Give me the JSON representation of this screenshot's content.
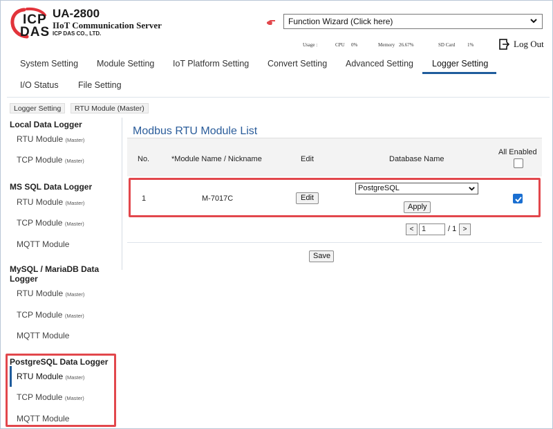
{
  "header": {
    "logo_line1": "ICP",
    "logo_line2": "DAS",
    "model": "UA-2800",
    "product": "IIoT Communication Server",
    "company": "ICP DAS CO., LTD.",
    "wizard_label": "Function Wizard  (Click here)",
    "usage": {
      "label": "Usage :",
      "cpu_label": "CPU",
      "cpu_value": "0%",
      "memory_label": "Memory",
      "memory_value": "26.67%",
      "sd_label": "SD Card",
      "sd_value": "1%"
    },
    "logout_label": "Log Out"
  },
  "tabs": {
    "system": "System Setting",
    "module": "Module Setting",
    "iot": "IoT Platform Setting",
    "convert": "Convert Setting",
    "advanced": "Advanced Setting",
    "logger": "Logger Setting",
    "io_status": "I/O Status",
    "file": "File Setting"
  },
  "breadcrumb": [
    "Logger Setting",
    "RTU Module (Master)"
  ],
  "sidebar": {
    "local": {
      "title": "Local Data Logger",
      "rtu": "RTU Module",
      "rtu_tag": "(Master)",
      "tcp": "TCP Module",
      "tcp_tag": "(Master)"
    },
    "mssql": {
      "title": "MS SQL Data Logger",
      "rtu": "RTU Module",
      "rtu_tag": "(Master)",
      "tcp": "TCP Module",
      "tcp_tag": "(Master)",
      "mqtt": "MQTT Module"
    },
    "mysql": {
      "title_line1": "MySQL / MariaDB Data",
      "title_line2": "Logger",
      "rtu": "RTU Module",
      "rtu_tag": "(Master)",
      "tcp": "TCP Module",
      "tcp_tag": "(Master)",
      "mqtt": "MQTT Module"
    },
    "postgres": {
      "title": "PostgreSQL Data Logger",
      "rtu": "RTU Module",
      "rtu_tag": "(Master)",
      "tcp": "TCP Module",
      "tcp_tag": "(Master)",
      "mqtt": "MQTT Module"
    }
  },
  "main": {
    "title": "Modbus RTU Module List",
    "columns": {
      "no": "No.",
      "name": "*Module Name / Nickname",
      "edit": "Edit",
      "db": "Database Name",
      "enabled": "All Enabled"
    },
    "row": {
      "no": "1",
      "name": "M-7017C",
      "edit_label": "Edit",
      "db_value": "PostgreSQL",
      "apply_label": "Apply"
    },
    "pager": {
      "prev": "<",
      "page": "1",
      "total": "/ 1",
      "next": ">"
    },
    "save_label": "Save"
  },
  "colors": {
    "accent": "#1f5c9c",
    "title": "#2a5c9a",
    "highlight": "#e2474c",
    "checkbox": "#1a6fd1"
  }
}
